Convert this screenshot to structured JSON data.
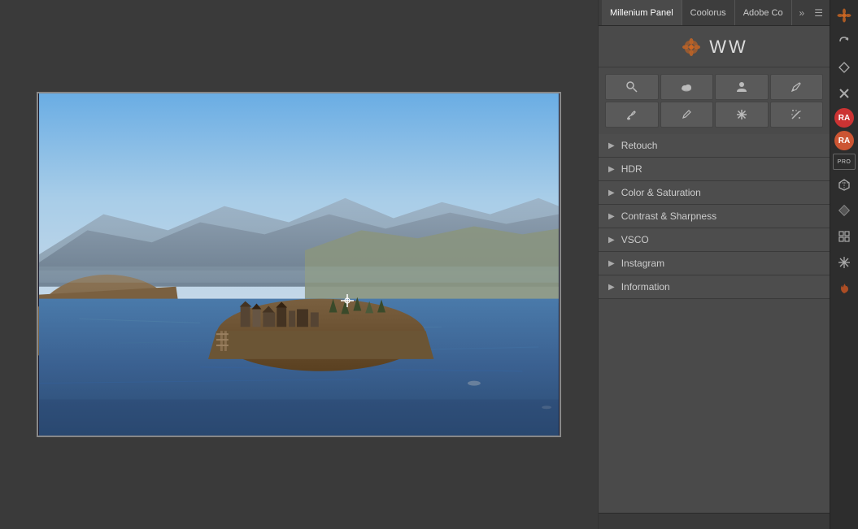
{
  "tabs": [
    {
      "label": "Millenium Panel",
      "active": true
    },
    {
      "label": "Coolorus",
      "active": false
    },
    {
      "label": "Adobe Co",
      "active": false
    }
  ],
  "logo": {
    "text": "WW"
  },
  "tools_row1": [
    {
      "name": "magnify",
      "icon": "🔍"
    },
    {
      "name": "cloud",
      "icon": "☁"
    },
    {
      "name": "person",
      "icon": "👤"
    },
    {
      "name": "pen",
      "icon": "✏"
    }
  ],
  "tools_row2": [
    {
      "name": "brush",
      "icon": "🖌"
    },
    {
      "name": "pencil",
      "icon": "✒"
    },
    {
      "name": "asterisk",
      "icon": "✳"
    },
    {
      "name": "wand",
      "icon": "🪄"
    }
  ],
  "panel_items": [
    {
      "label": "Retouch",
      "id": "retouch"
    },
    {
      "label": "HDR",
      "id": "hdr"
    },
    {
      "label": "Color & Saturation",
      "id": "color-saturation"
    },
    {
      "label": "Contrast & Sharpness",
      "id": "contrast-sharpness"
    },
    {
      "label": "VSCO",
      "id": "vsco"
    },
    {
      "label": "Instagram",
      "id": "instagram"
    },
    {
      "label": "Information",
      "id": "information"
    }
  ],
  "icon_bar": {
    "icons": [
      {
        "name": "flower-icon",
        "symbol": "✿"
      },
      {
        "name": "rotate-icon",
        "symbol": "↻"
      },
      {
        "name": "share-icon",
        "symbol": "⬡"
      },
      {
        "name": "tools-icon",
        "symbol": "✖"
      },
      {
        "name": "avatar-ra-1",
        "symbol": "RA",
        "type": "avatar",
        "color": "red"
      },
      {
        "name": "avatar-ra-2",
        "symbol": "RA",
        "type": "avatar",
        "color": "orange"
      },
      {
        "name": "pro-badge",
        "symbol": "PRO",
        "type": "pro"
      },
      {
        "name": "cube-icon",
        "symbol": "◈"
      },
      {
        "name": "gem-icon",
        "symbol": "◆"
      },
      {
        "name": "grid-icon",
        "symbol": "⊞"
      },
      {
        "name": "star-icon",
        "symbol": "✳"
      },
      {
        "name": "fire-icon",
        "symbol": "🔥"
      }
    ]
  }
}
